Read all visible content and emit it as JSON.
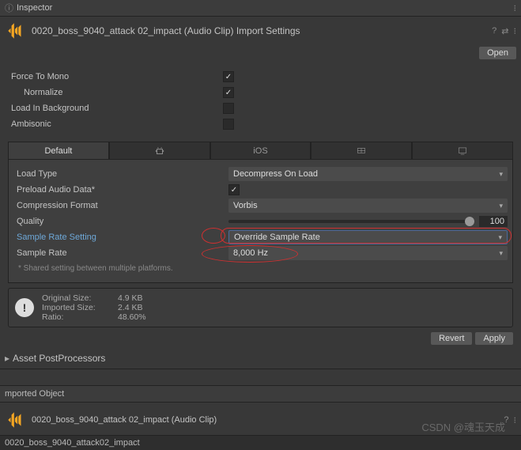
{
  "header": {
    "tab": "Inspector"
  },
  "asset": {
    "title": "0020_boss_9040_attack 02_impact (Audio Clip) Import Settings",
    "open_label": "Open"
  },
  "props": {
    "force_to_mono": "Force To Mono",
    "normalize": "Normalize",
    "load_in_bg": "Load In Background",
    "ambisonic": "Ambisonic"
  },
  "tabs": {
    "default": "Default",
    "ios": "iOS"
  },
  "settings": {
    "load_type_label": "Load Type",
    "load_type_value": "Decompress On Load",
    "preload_label": "Preload Audio Data*",
    "compression_label": "Compression Format",
    "compression_value": "Vorbis",
    "quality_label": "Quality",
    "quality_value": "100",
    "sample_rate_setting_label": "Sample Rate Setting",
    "sample_rate_setting_value": "Override Sample Rate",
    "sample_rate_label": "Sample Rate",
    "sample_rate_value": "8,000 Hz",
    "shared_note": "* Shared setting between multiple platforms."
  },
  "stats": {
    "orig_label": "Original Size:",
    "orig_value": "4.9 KB",
    "imp_label": "Imported Size:",
    "imp_value": "2.4 KB",
    "ratio_label": "Ratio:",
    "ratio_value": "48.60%"
  },
  "actions": {
    "revert": "Revert",
    "apply": "Apply"
  },
  "postproc": {
    "title": "Asset PostProcessors"
  },
  "imported": {
    "header": "mported Object",
    "title": "0020_boss_9040_attack 02_impact (Audio Clip)"
  },
  "footer": {
    "text": "0020_boss_9040_attack02_impact"
  },
  "watermark": "CSDN @魂玉天成"
}
